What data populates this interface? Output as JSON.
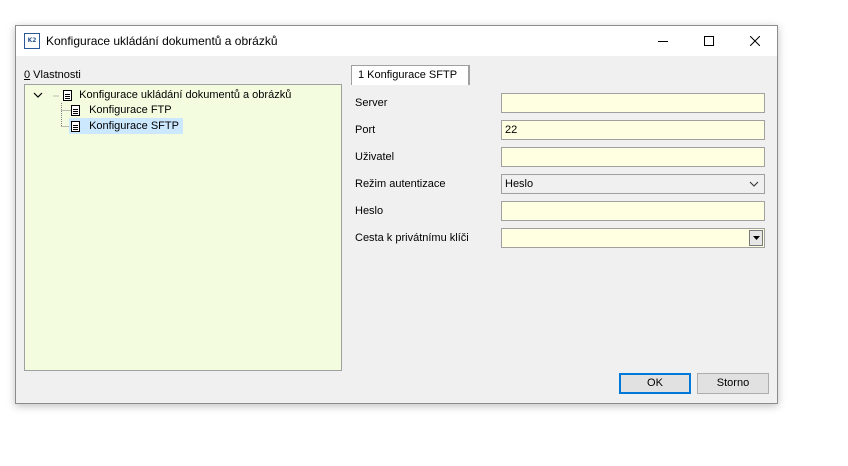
{
  "window": {
    "title": "Konfigurace ukládání dokumentů a obrázků",
    "app_icon_text": "K2",
    "controls": [
      "minimize-icon",
      "maximize-icon",
      "close-icon"
    ]
  },
  "properties_panel": {
    "label_hotkey": "0",
    "label_rest": " Vlastnosti",
    "tree": {
      "root": "Konfigurace ukládání dokumentů a obrázků",
      "children": [
        "Konfigurace FTP",
        "Konfigurace SFTP"
      ],
      "selected": "Konfigurace SFTP"
    },
    "background_color": "#f4fce0"
  },
  "tab": {
    "label": "1 Konfigurace SFTP"
  },
  "form": {
    "fields": [
      {
        "label": "Server",
        "value": ""
      },
      {
        "label": "Port",
        "value": "22"
      },
      {
        "label": "Uživatel",
        "value": ""
      },
      {
        "label": "Režim autentizace",
        "value": "Heslo"
      },
      {
        "label": "Heslo",
        "value": ""
      },
      {
        "label": "Cesta k privátnímu klíči",
        "value": ""
      }
    ],
    "field_color": "#ffffe1"
  },
  "buttons": {
    "ok": "OK",
    "cancel": "Storno"
  },
  "colors": {
    "selection": "#cce8ff",
    "accent": "#0078d7"
  }
}
